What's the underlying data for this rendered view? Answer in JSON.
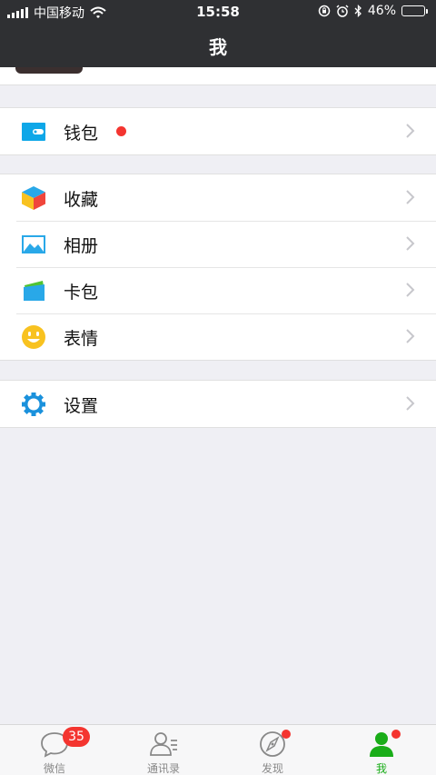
{
  "status_bar": {
    "carrier": "中国移动",
    "time": "15:58",
    "battery_percent": "46%",
    "battery_level": 0.46
  },
  "header": {
    "title": "我"
  },
  "groups": [
    {
      "items": [
        {
          "label": "钱包",
          "icon": "wallet-icon",
          "has_red_dot": true
        }
      ]
    },
    {
      "items": [
        {
          "label": "收藏",
          "icon": "favorites-cube-icon"
        },
        {
          "label": "相册",
          "icon": "album-icon"
        },
        {
          "label": "卡包",
          "icon": "card-pack-icon"
        },
        {
          "label": "表情",
          "icon": "smiley-icon"
        }
      ]
    },
    {
      "items": [
        {
          "label": "设置",
          "icon": "gear-icon"
        }
      ]
    }
  ],
  "tabbar": {
    "tabs": [
      {
        "label": "微信",
        "icon": "chat-bubble-icon",
        "badge": "35"
      },
      {
        "label": "通讯录",
        "icon": "contacts-icon"
      },
      {
        "label": "发现",
        "icon": "compass-icon",
        "has_red_dot": true
      },
      {
        "label": "我",
        "icon": "person-icon",
        "active": true,
        "has_red_dot": true
      }
    ]
  },
  "colors": {
    "header_bg": "#2f3033",
    "page_bg": "#efeff4",
    "accent_green": "#1aad19",
    "badge_red": "#f43530"
  }
}
